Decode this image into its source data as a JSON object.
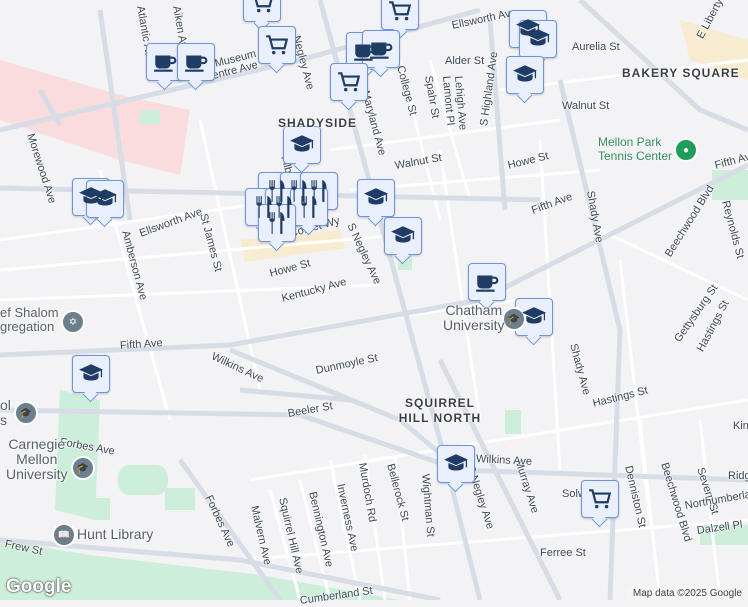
{
  "map": {
    "labels": [
      "Ellsworth Ave",
      "Centre Ave",
      "Morewood Ave",
      "Amberson Ave",
      "St James St",
      "Fifth Ave",
      "Wilkins Ave",
      "Dunmoyle St",
      "Beeler St",
      "Forbes Ave",
      "Forbes Ave",
      "Frew St",
      "Malvern Ave",
      "Squirrel Hill Ave",
      "Bennington Ave",
      "Inverness Ave",
      "Murdoch Rd",
      "Bellerock St",
      "Wightman St",
      "S Negley Ave",
      "Murray Ave",
      "Wilkins Ave",
      "Ferree St",
      "Solway St",
      "Denniston St",
      "Beechwood Blvd",
      "Severn St",
      "Northumberland St",
      "Dalzell Pl",
      "Hastings St",
      "Gettysburg St",
      "Hastings St",
      "Shady Ave",
      "Shady Ave",
      "Beechwood Blvd",
      "Reynolds St",
      "Fifth Ave",
      "Fifth Ave",
      "Howe St",
      "Walnut St",
      "Aurelia St",
      "E Liberty Blvd",
      "Ellsworth Ave",
      "Alder St",
      "Spahr St",
      "Lamont Pl",
      "Lehigh Ave",
      "S Highland Ave",
      "College St",
      "Maryland Ave",
      "Negley Ave",
      "Comet Wy",
      "Howe St",
      "Kentucky Ave",
      "S Negley Ave",
      "Cumberland St",
      "Walnut St",
      "Ridge",
      "Kin",
      "Aiken Ave",
      "Atlantic Av",
      "Museum Blvd",
      "Filbert St"
    ],
    "areas": [
      "SHADYSIDE",
      "BAKERY SQUARE",
      "SQUIRREL HILL NORTH"
    ],
    "pois": {
      "cmu": "Carnegie\nMellon\nUniversity",
      "hunt": "Hunt Library",
      "chatham": "Chatham\nUniversity",
      "rodef": "ef Shalom\ngregation",
      "tennis": "Mellon Park\nTennis Center",
      "school": "ol\ns"
    },
    "markers": [
      "shopping-cart",
      "shopping-cart",
      "shopping-cart",
      "coffee",
      "coffee",
      "coffee",
      "coffee",
      "shopping-cart",
      "school",
      "school",
      "school",
      "school",
      "school",
      "school",
      "restaurant",
      "restaurant",
      "restaurant",
      "restaurant",
      "restaurant",
      "restaurant",
      "restaurant",
      "school",
      "school",
      "coffee",
      "school",
      "school",
      "school",
      "shopping-cart"
    ],
    "attribution": "Map data ©2025 Google",
    "logo": "Google"
  },
  "colors": {
    "marker_bg": "#e9effd",
    "marker_border": "#6d95dc",
    "marker_icon": "#1f3d64",
    "park": "#c9ecd4",
    "road": "#d6dde6"
  }
}
